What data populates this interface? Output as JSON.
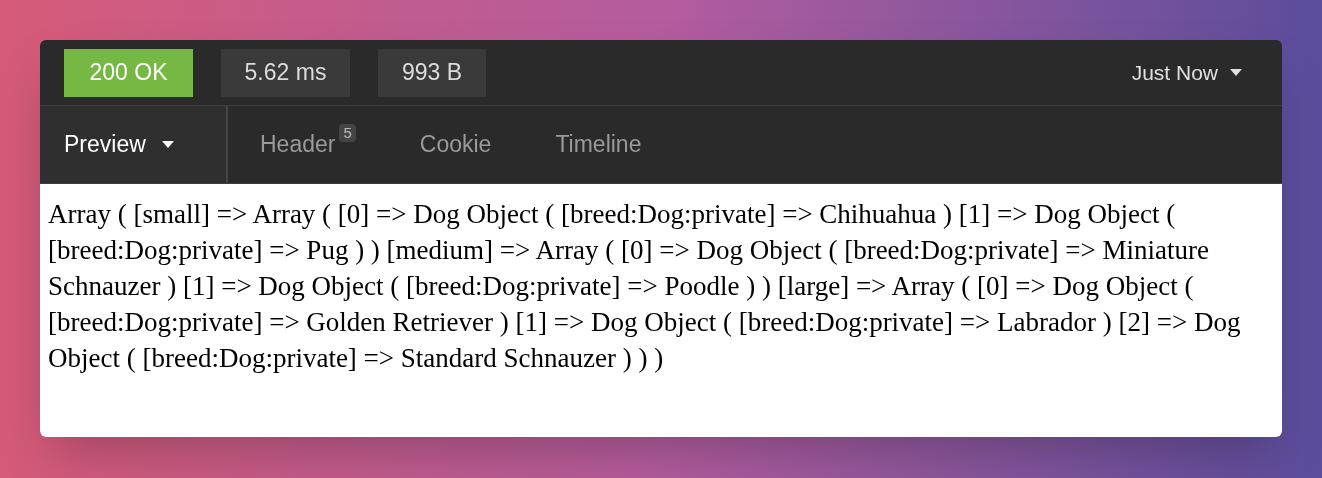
{
  "status_bar": {
    "status": "200 OK",
    "time": "5.62 ms",
    "size": "993 B",
    "timestamp": "Just Now"
  },
  "tabs": [
    {
      "label": "Preview",
      "selected": true,
      "dropdown": true
    },
    {
      "label": "Header",
      "selected": false,
      "count": "5"
    },
    {
      "label": "Cookie",
      "selected": false
    },
    {
      "label": "Timeline",
      "selected": false
    }
  ],
  "preview": {
    "text": "Array ( [small] => Array ( [0] => Dog Object ( [breed:Dog:private] => Chihuahua ) [1] => Dog Object ( [breed:Dog:private] => Pug ) ) [medium] => Array ( [0] => Dog Object ( [breed:Dog:private] => Miniature Schnauzer ) [1] => Dog Object ( [breed:Dog:private] => Poodle ) ) [large] => Array ( [0] => Dog Object ( [breed:Dog:private] => Golden Retriever ) [1] => Dog Object ( [breed:Dog:private] => Labrador ) [2] => Dog Object ( [breed:Dog:private] => Standard Schnauzer ) ) )"
  }
}
